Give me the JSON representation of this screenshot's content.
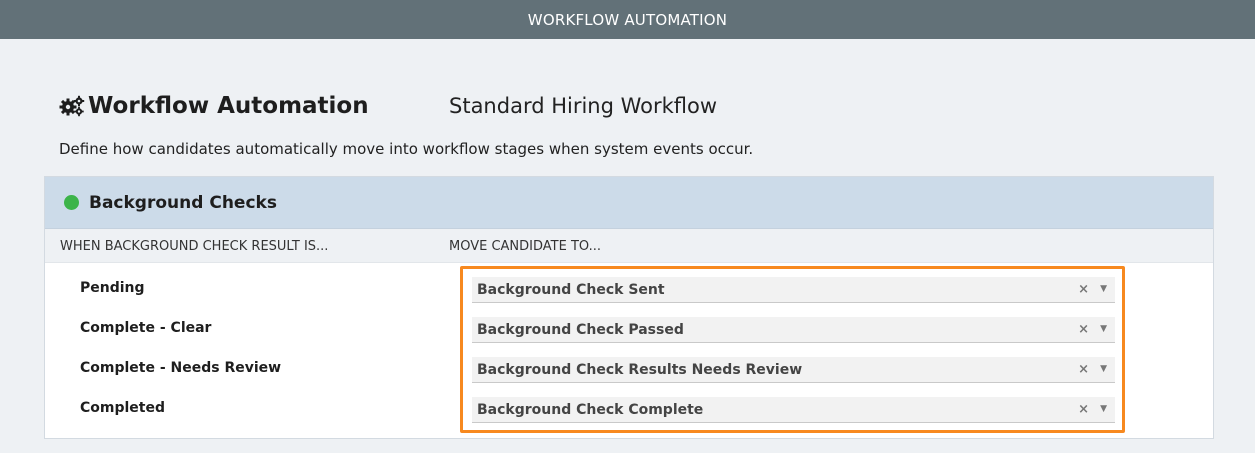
{
  "topbar": {
    "title": "WORKFLOW AUTOMATION"
  },
  "header": {
    "icon": "gears-icon",
    "title": "Workflow Automation",
    "workflow_name": "Standard Hiring Workflow",
    "description": "Define how candidates automatically move into workflow stages when system events occur."
  },
  "section": {
    "title": "Background Checks",
    "status_color": "#3cb44a",
    "col_when": "WHEN BACKGROUND CHECK RESULT IS...",
    "col_move": "MOVE CANDIDATE TO...",
    "rows": [
      {
        "result": "Pending",
        "stage": "Background Check Sent"
      },
      {
        "result": "Complete - Clear",
        "stage": "Background Check Passed"
      },
      {
        "result": "Complete - Needs Review",
        "stage": "Background Check Results Needs Review"
      },
      {
        "result": "Completed",
        "stage": "Background Check Complete"
      }
    ]
  },
  "select_controls": {
    "clear_glyph": "×",
    "caret_glyph": "▼"
  },
  "colors": {
    "topbar": "#627178",
    "highlight": "#f7891f",
    "header_bg": "#ccdbe9"
  }
}
